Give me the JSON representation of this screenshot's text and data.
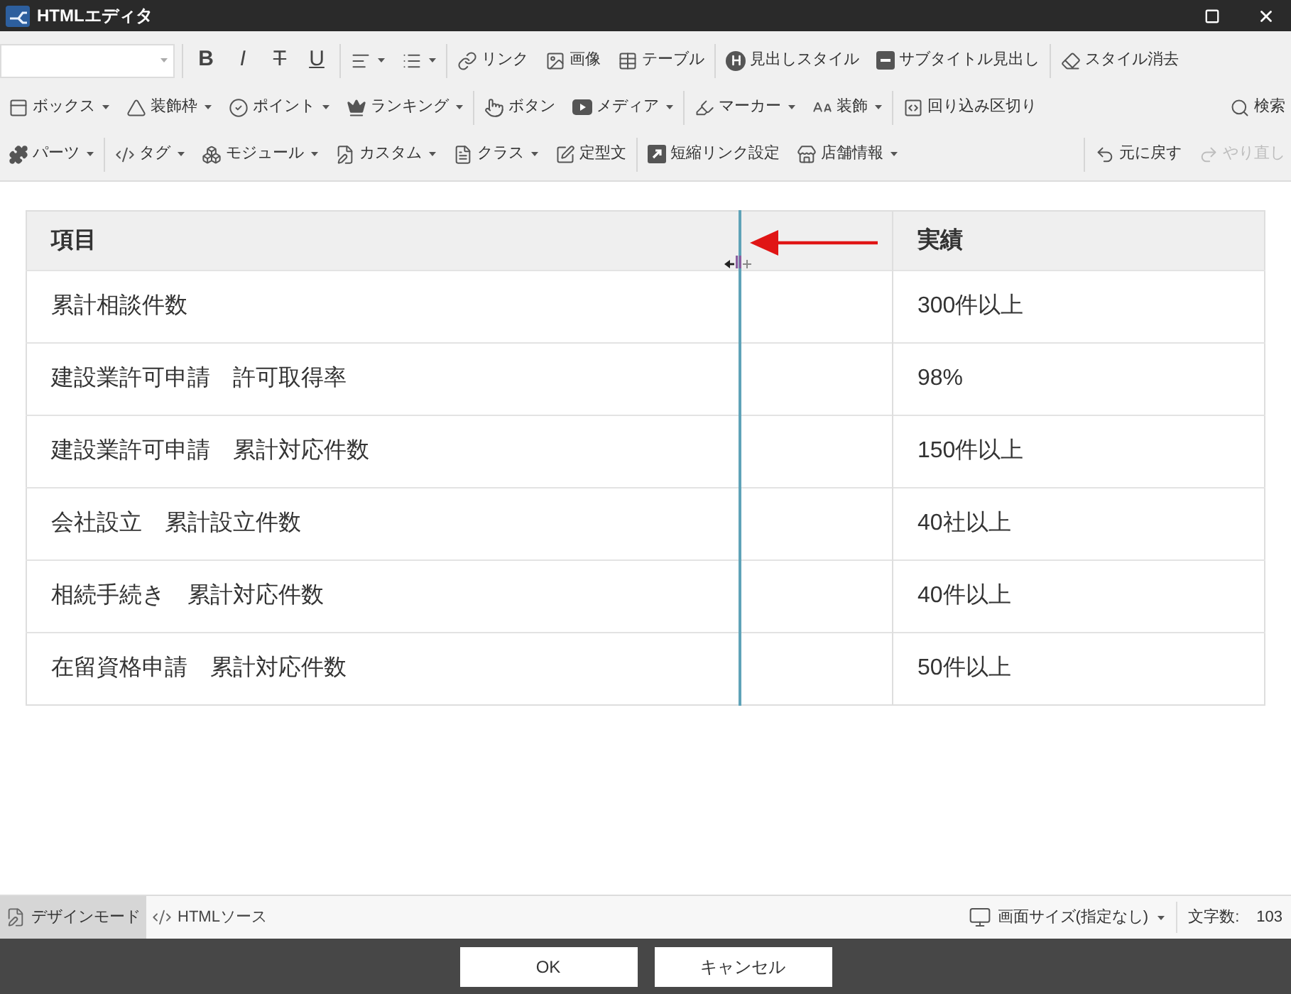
{
  "window": {
    "title": "HTMLエディタ"
  },
  "toolbar": {
    "rows": [
      {
        "groups": [
          [
            {
              "kind": "select"
            }
          ],
          [
            {
              "kind": "bold",
              "label": "B"
            },
            {
              "kind": "italic",
              "label": "I"
            },
            {
              "kind": "strike",
              "label": "T"
            },
            {
              "kind": "underline",
              "label": "U"
            }
          ],
          [
            {
              "kind": "menu"
            },
            {
              "kind": "menu"
            }
          ],
          [
            {
              "kind": "button",
              "label": "リンク"
            },
            {
              "kind": "button",
              "label": "画像"
            },
            {
              "kind": "button",
              "label": "テーブル"
            }
          ],
          [
            {
              "kind": "button",
              "label": "見出しスタイル"
            },
            {
              "kind": "button",
              "label": "サブタイトル見出し"
            }
          ],
          [
            {
              "kind": "button",
              "label": "スタイル消去"
            }
          ]
        ]
      },
      {
        "groups": [
          [
            {
              "kind": "menu",
              "label": "ボックス"
            },
            {
              "kind": "menu",
              "label": "装飾枠"
            },
            {
              "kind": "menu",
              "label": "ポイント"
            },
            {
              "kind": "menu",
              "label": "ランキング"
            }
          ],
          [
            {
              "kind": "button",
              "label": "ボタン"
            },
            {
              "kind": "menu",
              "label": "メディア"
            }
          ],
          [
            {
              "kind": "menu",
              "label": "マーカー"
            },
            {
              "kind": "menu",
              "label": "装飾"
            }
          ],
          [
            {
              "kind": "button",
              "label": "回り込み区切り"
            }
          ]
        ],
        "right": {
          "divided": false,
          "items": [
            {
              "kind": "button",
              "label": "検索"
            }
          ]
        }
      },
      {
        "groups": [
          [
            {
              "kind": "menu",
              "label": "パーツ"
            }
          ],
          [
            {
              "kind": "menu",
              "label": "タグ"
            },
            {
              "kind": "menu",
              "label": "モジュール"
            },
            {
              "kind": "menu",
              "label": "カスタム"
            },
            {
              "kind": "menu",
              "label": "クラス"
            },
            {
              "kind": "button",
              "label": "定型文"
            }
          ],
          [
            {
              "kind": "button",
              "label": "短縮リンク設定"
            },
            {
              "kind": "menu",
              "label": "店舗情報"
            }
          ]
        ],
        "right": {
          "divided": true,
          "items": [
            {
              "kind": "button",
              "label": "元に戻す",
              "disabled": false
            },
            {
              "kind": "button",
              "label": "やり直し",
              "disabled": true
            }
          ]
        }
      }
    ]
  },
  "table": {
    "columns": [
      "項目",
      "実績"
    ],
    "rows": [
      [
        "累計相談件数",
        "300件以上"
      ],
      [
        "建設業許可申請　許可取得率",
        "98%"
      ],
      [
        "建設業許可申請　累計対応件数",
        "150件以上"
      ],
      [
        "会社設立　累計設立件数",
        "40社以上"
      ],
      [
        "相続手続き　累計対応件数",
        "40件以上"
      ],
      [
        "在留資格申請　累計対応件数",
        "50件以上"
      ]
    ]
  },
  "status_bar": {
    "modes": [
      {
        "label": "デザインモード",
        "selected": true
      },
      {
        "label": "HTMLソース",
        "selected": false
      }
    ],
    "screen_size": "画面サイズ(指定なし)",
    "char_count": {
      "label": "文字数:",
      "value": "103"
    }
  },
  "buttons": [
    "OK",
    "キャンセル"
  ]
}
